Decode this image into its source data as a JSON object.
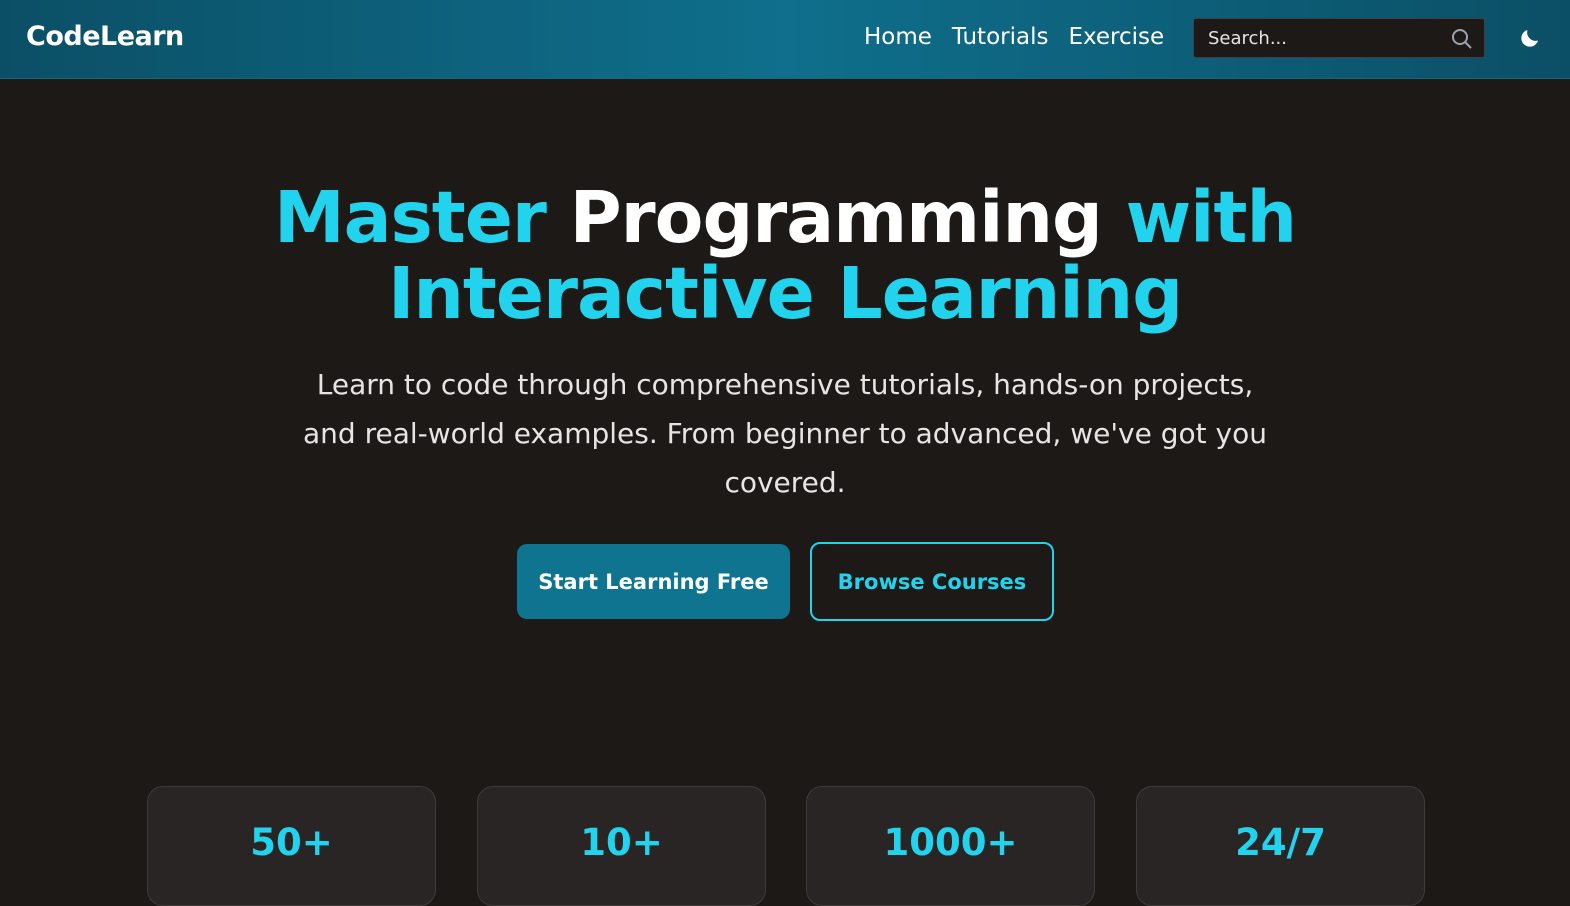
{
  "header": {
    "brand": "CodeLearn",
    "nav": [
      "Home",
      "Tutorials",
      "Exercise"
    ],
    "search_placeholder": "Search..."
  },
  "hero": {
    "title_part1": "Master",
    "title_part2": "Programming",
    "title_part3": "with",
    "title_part4": "Interactive Learning",
    "description": "Learn to code through comprehensive tutorials, hands-on projects, and real-world examples. From beginner to advanced, we've got you covered.",
    "primary_button": "Start Learning Free",
    "secondary_button": "Browse Courses"
  },
  "stats": [
    {
      "value": "50+"
    },
    {
      "value": "10+"
    },
    {
      "value": "1000+"
    },
    {
      "value": "24/7"
    }
  ],
  "colors": {
    "accent": "#22d3ee",
    "primary": "#0e7490",
    "background": "#1c1917",
    "card": "#292524"
  }
}
